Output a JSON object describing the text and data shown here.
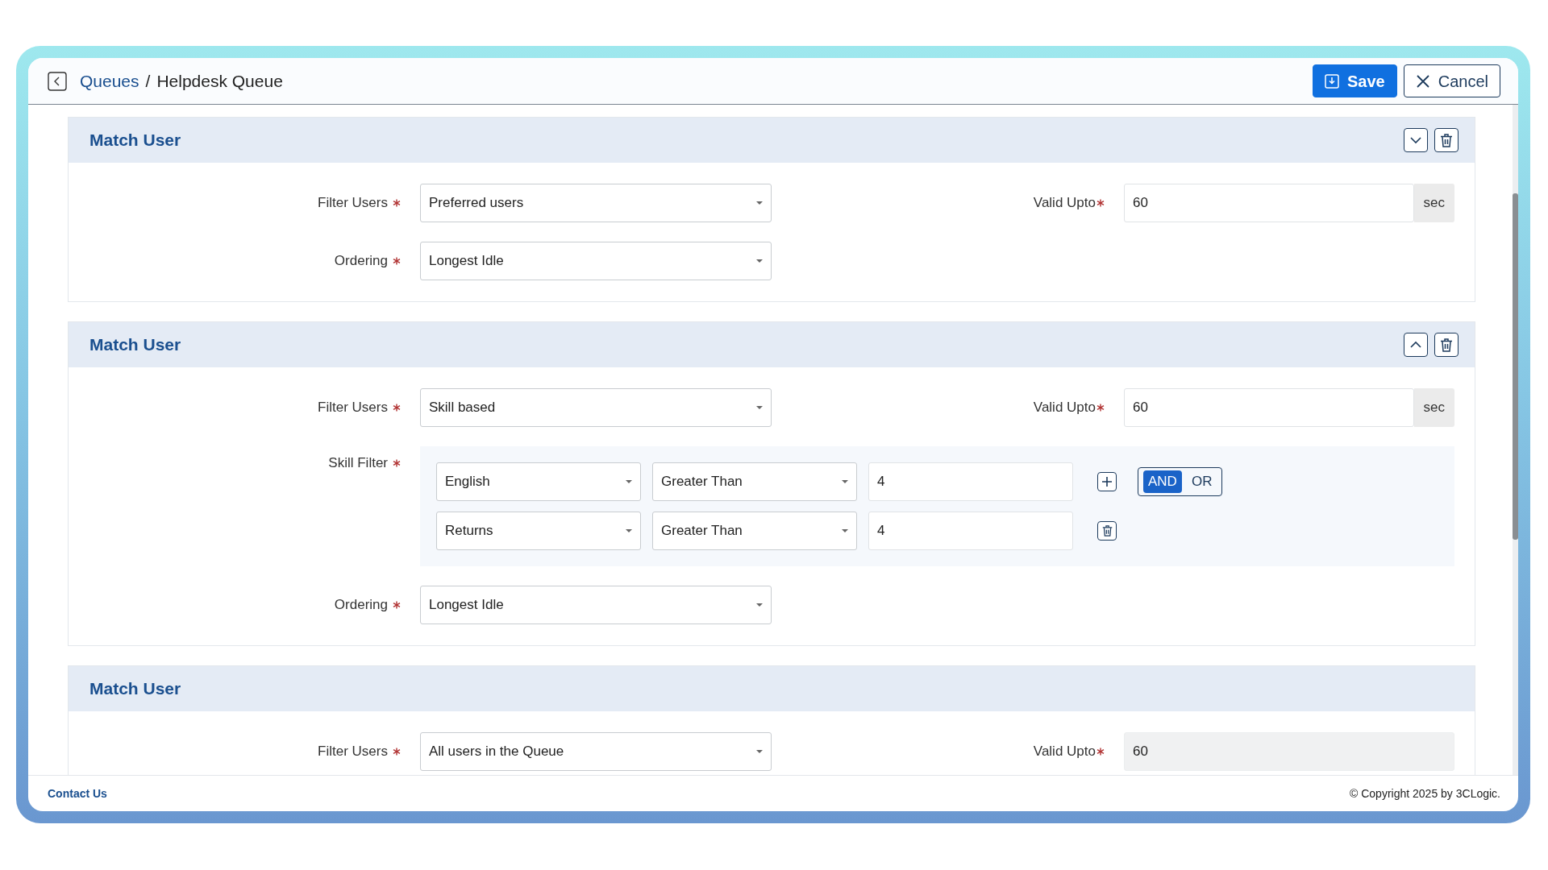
{
  "header": {
    "breadcrumb": [
      {
        "label": "Queues",
        "kind": "link"
      },
      {
        "label": "Helpdesk Queue",
        "kind": "current"
      }
    ],
    "separator": "/",
    "buttons": [
      {
        "label": "Save",
        "kind": "primary"
      },
      {
        "label": "Cancel",
        "kind": "secondary"
      }
    ]
  },
  "sections": [
    {
      "title": "Match User",
      "collapsible": true,
      "expanded": false,
      "deletable": true,
      "fields": [
        {
          "label": "Filter Users",
          "required": true,
          "kind": "select",
          "value": "Preferred users"
        },
        {
          "label": "Ordering",
          "required": true,
          "kind": "select",
          "value": "Longest Idle"
        }
      ],
      "side": {
        "label": "Valid Upto",
        "required": true,
        "value": "60",
        "unit": "sec",
        "disabled": false
      }
    },
    {
      "title": "Match User",
      "collapsible": true,
      "expanded": true,
      "deletable": true,
      "fields": [
        {
          "label": "Filter Users",
          "required": true,
          "kind": "select",
          "value": "Skill based"
        },
        {
          "label": "Skill Filter",
          "required": true,
          "kind": "skill_filter",
          "rows": [
            {
              "skill": "English",
              "operator": "Greater Than",
              "value": "4",
              "kind": "add",
              "logic": [
                {
                  "label": "AND",
                  "selected": true
                },
                {
                  "label": "OR",
                  "selected": false
                }
              ]
            },
            {
              "skill": "Returns",
              "operator": "Greater Than",
              "value": "4",
              "kind": "remove"
            }
          ]
        },
        {
          "label": "Ordering",
          "required": true,
          "kind": "select",
          "value": "Longest Idle"
        }
      ],
      "side": {
        "label": "Valid Upto",
        "required": true,
        "value": "60",
        "unit": "sec",
        "disabled": false
      }
    },
    {
      "title": "Match User",
      "collapsible": false,
      "deletable": false,
      "fields": [
        {
          "label": "Filter Users",
          "required": true,
          "kind": "select",
          "value": "All users in the Queue"
        }
      ],
      "side": {
        "label": "Valid Upto",
        "required": true,
        "value": "60",
        "disabled": true
      }
    }
  ],
  "footer": {
    "link": "Contact Us",
    "copyright": "© Copyright 2025 by 3CLogic."
  }
}
